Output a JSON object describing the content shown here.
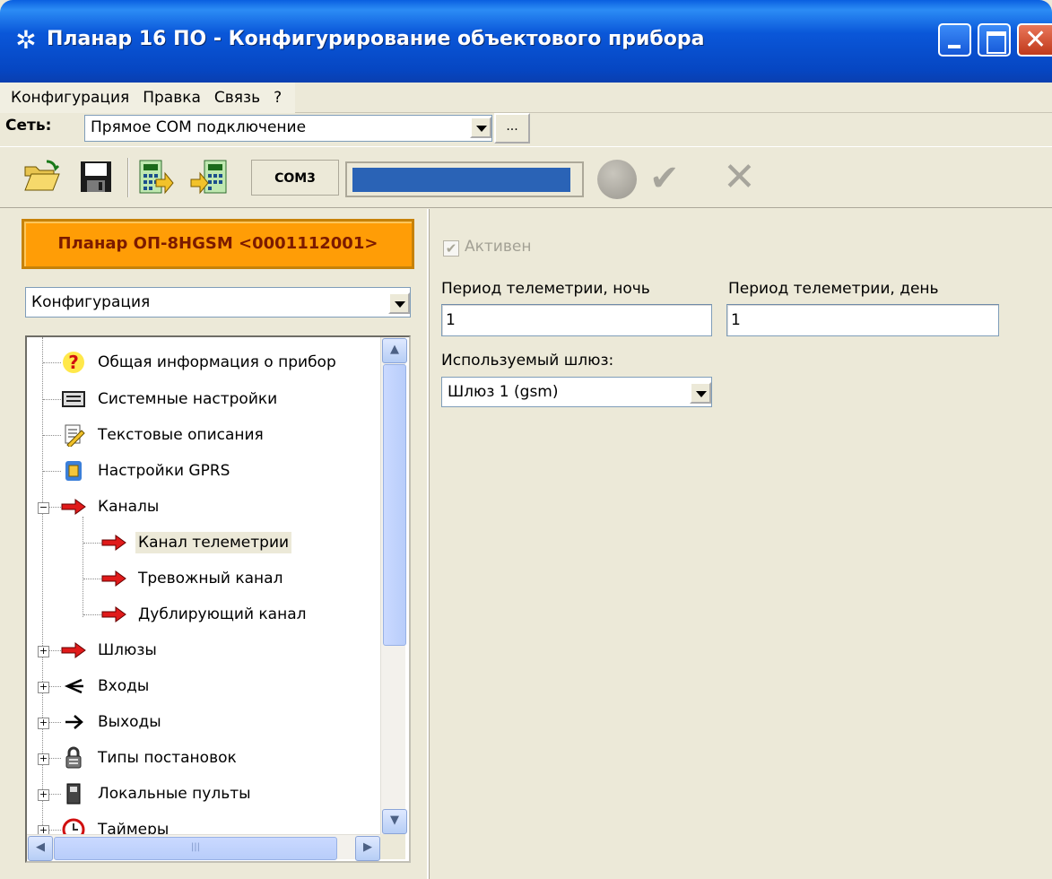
{
  "window": {
    "title": "Планар 16 ПО - Конфигурирование объектового прибора"
  },
  "menu": [
    "Конфигурация",
    "Правка",
    "Связь",
    "?"
  ],
  "network": {
    "label": "Сеть:",
    "value": "Прямое COM подключение",
    "more_button": "..."
  },
  "toolbar": {
    "port": "COM3",
    "progress_fraction": 0.97
  },
  "device": {
    "banner": "Планар ОП-8HGSM <0001112001>"
  },
  "section_select": {
    "value": "Конфигурация"
  },
  "tree": {
    "items": [
      {
        "label": "Общая информация о прибор",
        "icon": "question-icon"
      },
      {
        "label": "Системные настройки",
        "icon": "system-settings-icon"
      },
      {
        "label": "Текстовые описания",
        "icon": "text-notes-icon"
      },
      {
        "label": "Настройки GPRS",
        "icon": "sim-card-icon"
      },
      {
        "label": "Каналы",
        "icon": "red-arrow-icon",
        "expanded": true
      },
      {
        "label": "Канал телеметрии",
        "icon": "red-arrow-icon",
        "selected": true
      },
      {
        "label": "Тревожный канал",
        "icon": "red-arrow-icon"
      },
      {
        "label": "Дублирующий канал",
        "icon": "red-arrow-icon"
      },
      {
        "label": "Шлюзы",
        "icon": "red-arrow-icon"
      },
      {
        "label": "Входы",
        "icon": "input-fork-icon"
      },
      {
        "label": "Выходы",
        "icon": "output-arrow-icon"
      },
      {
        "label": "Типы постановок",
        "icon": "padlock-icon"
      },
      {
        "label": "Локальные пульты",
        "icon": "keypad-icon"
      },
      {
        "label": "Таймеры",
        "icon": "clock-icon"
      }
    ]
  },
  "form": {
    "active_label": "Активен",
    "active_checked": true,
    "night_label": "Период телеметрии, ночь",
    "night_value": "1",
    "day_label": "Период телеметрии, день",
    "day_value": "1",
    "gateway_label": "Используемый шлюз:",
    "gateway_value": "Шлюз 1 (gsm)"
  },
  "colors": {
    "titlebar": "#0a57d9",
    "device_banner": "#ff9d06",
    "progress": "#2a63b6",
    "selection": "#ece9d8"
  }
}
